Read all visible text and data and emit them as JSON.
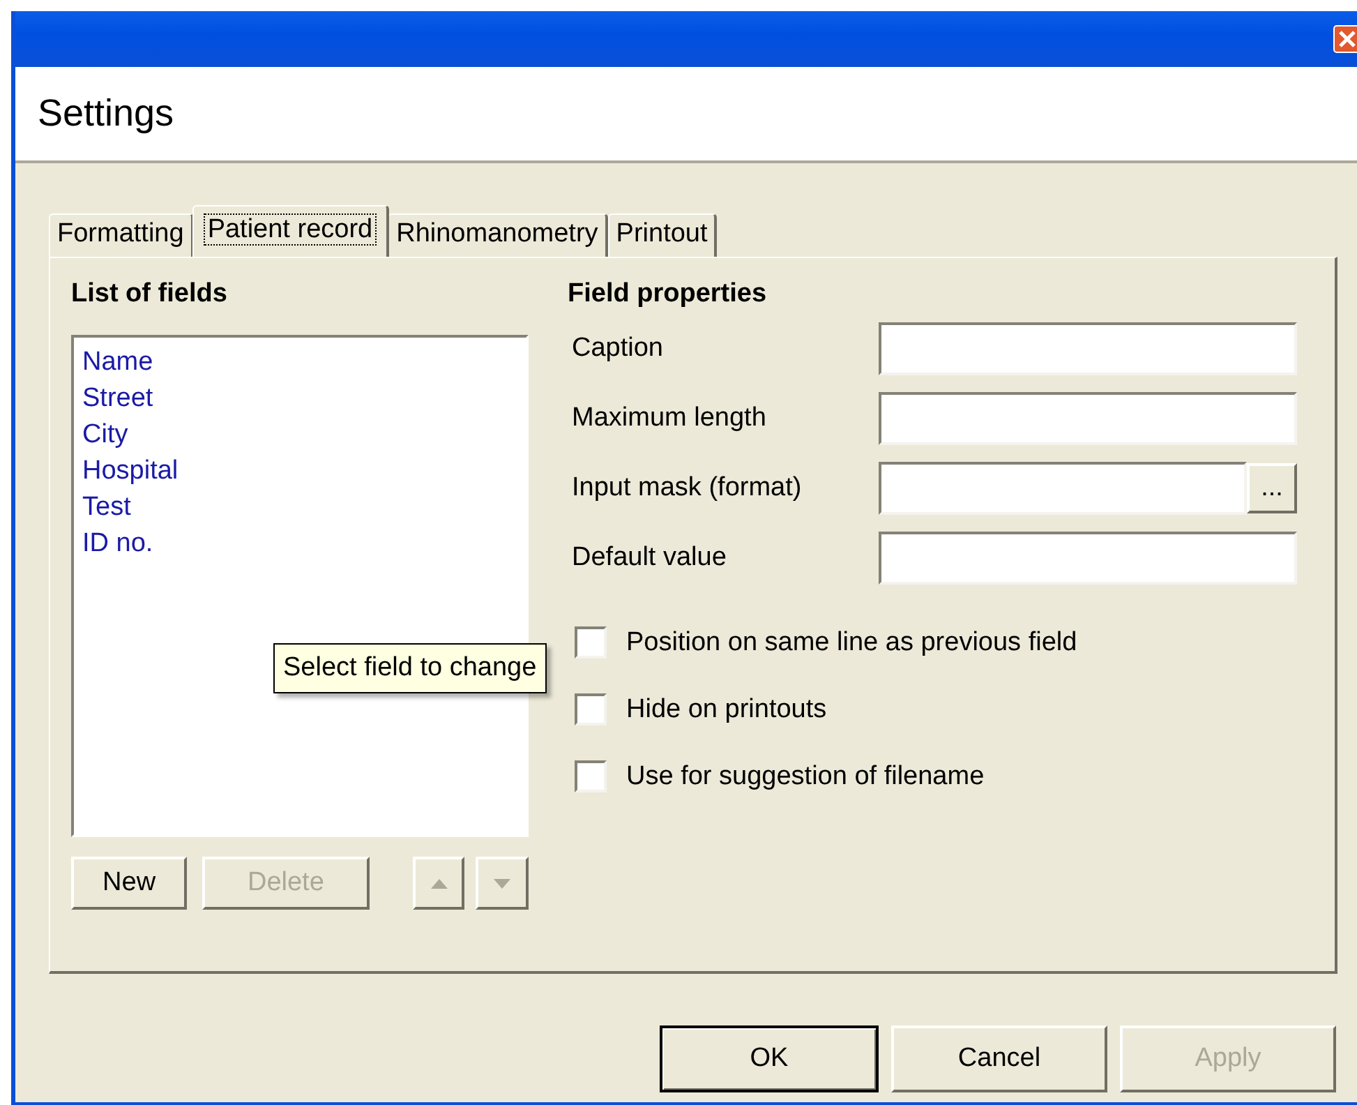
{
  "window": {
    "heading": "Settings"
  },
  "tabs": [
    {
      "label": "Formatting",
      "selected": false
    },
    {
      "label": "Patient record",
      "selected": true
    },
    {
      "label": "Rhinomanometry",
      "selected": false
    },
    {
      "label": "Printout",
      "selected": false
    }
  ],
  "list_panel": {
    "title": "List of fields",
    "items": [
      {
        "label": "Name",
        "selected": false
      },
      {
        "label": "Street",
        "selected": false
      },
      {
        "label": "City",
        "selected": false
      },
      {
        "label": "Hospital",
        "selected": false
      },
      {
        "label": "Test",
        "selected": false
      },
      {
        "label": "ID no.",
        "selected": false
      }
    ],
    "buttons": [
      {
        "kind": "text",
        "label": "New",
        "disabled": false
      },
      {
        "kind": "text",
        "label": "Delete",
        "disabled": true
      },
      {
        "kind": "up",
        "disabled": true
      },
      {
        "kind": "down",
        "disabled": true
      }
    ]
  },
  "properties": {
    "title": "Field properties",
    "fields": [
      {
        "kind": "text",
        "label": "Caption"
      },
      {
        "kind": "text",
        "label": "Maximum length"
      },
      {
        "kind": "browse",
        "label": "Input mask (format)",
        "button": "..."
      },
      {
        "kind": "text",
        "label": "Default value"
      }
    ],
    "checkboxes": [
      {
        "label": "Position on same line as previous field",
        "checked": false
      },
      {
        "label": "Hide on printouts",
        "checked": false
      },
      {
        "label": "Use for suggestion of filename",
        "checked": false
      }
    ]
  },
  "tooltip": "Select field to change",
  "footer_buttons": [
    {
      "label": "OK",
      "default": true,
      "disabled": false
    },
    {
      "label": "Cancel",
      "default": false,
      "disabled": false
    },
    {
      "label": "Apply",
      "default": false,
      "disabled": true
    }
  ]
}
